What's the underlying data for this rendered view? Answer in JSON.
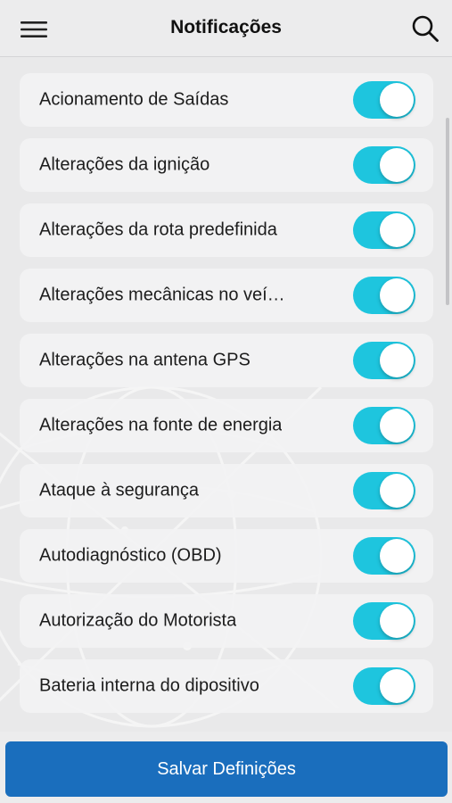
{
  "header": {
    "title": "Notificações",
    "menu_icon": "hamburger-menu-icon",
    "search_icon": "search-icon"
  },
  "notifications": [
    {
      "label": "Acionamento de Saídas",
      "enabled": true
    },
    {
      "label": "Alterações da ignição",
      "enabled": true
    },
    {
      "label": "Alterações da rota predefinida",
      "enabled": true
    },
    {
      "label": "Alterações mecânicas no veí…",
      "enabled": true
    },
    {
      "label": "Alterações na antena GPS",
      "enabled": true
    },
    {
      "label": "Alterações na fonte de energia",
      "enabled": true
    },
    {
      "label": "Ataque à segurança",
      "enabled": true
    },
    {
      "label": "Autodiagnóstico (OBD)",
      "enabled": true
    },
    {
      "label": "Autorização do Motorista",
      "enabled": true
    },
    {
      "label": "Bateria interna do dipositivo",
      "enabled": true
    }
  ],
  "footer": {
    "save_label": "Salvar Definições"
  },
  "colors": {
    "toggle_on": "#1ec5de",
    "primary_button": "#1a6ebd",
    "background": "#e9e9ea"
  }
}
